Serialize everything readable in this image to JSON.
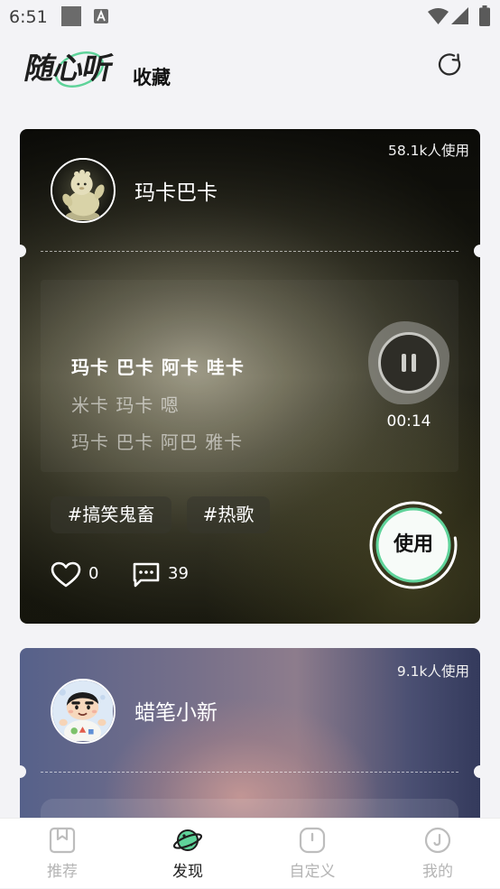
{
  "status_bar": {
    "time": "6:51",
    "icons": [
      "notification-square-icon",
      "app-a-icon",
      "wifi-icon",
      "signal-icon",
      "battery-icon"
    ]
  },
  "header": {
    "logo": "随心听",
    "title": "收藏",
    "action_icon": "refresh-icon"
  },
  "colors": {
    "accent": "#5fd39a",
    "page_bg": "#f3f3f6",
    "nav_active": "#1e1e1e",
    "nav_inactive": "#b4b4b4"
  },
  "cards": [
    {
      "usage": "58.1k人使用",
      "name": "玛卡巴卡",
      "lyrics": {
        "current": "玛卡 巴卡 阿卡 哇卡",
        "upcoming": [
          "米卡 玛卡 嗯",
          "玛卡 巴卡 阿巴 雅卡"
        ]
      },
      "player": {
        "control_icon": "pause-icon",
        "time": "00:14"
      },
      "tags": [
        "#搞笑鬼畜",
        "#热歌"
      ],
      "use_label": "使用",
      "like_icon": "heart-icon",
      "likes": "0",
      "comment_icon": "comment-icon",
      "comments": "39"
    },
    {
      "usage": "9.1k人使用",
      "name": "蜡笔小新"
    }
  ],
  "nav": {
    "items": [
      {
        "label": "推荐",
        "icon": "bookmark-icon",
        "active": false
      },
      {
        "label": "发现",
        "icon": "planet-icon",
        "active": true
      },
      {
        "label": "自定义",
        "icon": "custom-icon",
        "active": false
      },
      {
        "label": "我的",
        "icon": "profile-icon",
        "active": false
      }
    ]
  }
}
